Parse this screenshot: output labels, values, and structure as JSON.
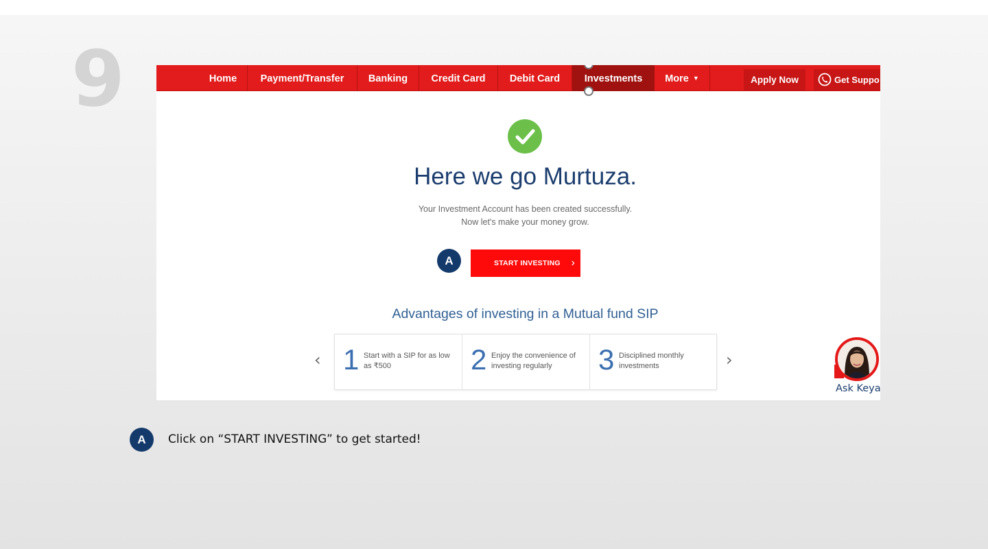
{
  "step_number": "9",
  "nav": {
    "items": [
      {
        "label": "Home"
      },
      {
        "label": "Payment/Transfer"
      },
      {
        "label": "Banking"
      },
      {
        "label": "Credit Card"
      },
      {
        "label": "Debit Card"
      },
      {
        "label": "Investments"
      },
      {
        "label": "More"
      }
    ],
    "active": "Investments",
    "apply_label": "Apply Now",
    "support_label": "Get Suppo"
  },
  "success": {
    "headline": "Here we go Murtuza.",
    "line1": "Your Investment Account has been created successfully.",
    "line2": "Now let's make your money grow.",
    "button_label": "START INVESTING",
    "check_color": "#6cc04a"
  },
  "advantages": {
    "title": "Advantages of investing in a Mutual fund SIP",
    "cards": [
      {
        "num": "1",
        "text": "Start with a SIP for as low as ₹500"
      },
      {
        "num": "2",
        "text": "Enjoy the convenience of investing regularly"
      },
      {
        "num": "3",
        "text": "Disciplined monthly investments"
      }
    ]
  },
  "chat": {
    "label": "Ask Keya"
  },
  "callout": {
    "marker": "A",
    "instruction": "Click on “START INVESTING” to get started!"
  },
  "colors": {
    "nav_red": "#e21c1c",
    "button_red": "#ff0a0a",
    "marker_navy": "#143a6b",
    "heading_blue": "#1b3d6e"
  }
}
